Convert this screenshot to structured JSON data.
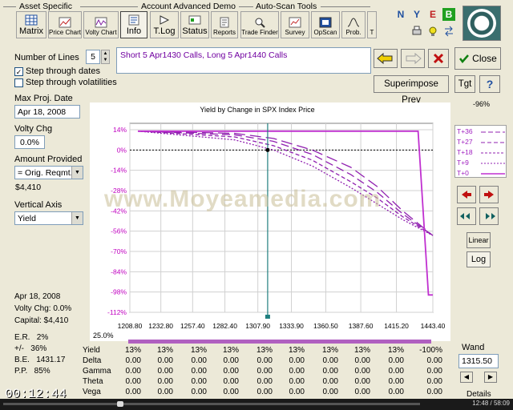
{
  "toolbar": {
    "groups": {
      "asset": "Asset Specific",
      "account": "Account Advanced Demo",
      "autoscan": "Auto-Scan Tools"
    },
    "buttons": {
      "matrix": "Matrix",
      "price_chart": "Price Chart",
      "volty_chart": "Volty Chart",
      "info": "Info",
      "tlog": "T.Log",
      "status": "Status",
      "reports": "Reports",
      "trade_finder": "Trade Finder",
      "survey": "Survey",
      "opscan": "OpScan",
      "prob": "Prob.",
      "extra": "T"
    }
  },
  "right_icons": [
    "N",
    "Y",
    "E",
    "B"
  ],
  "left_panel": {
    "num_lines_label": "Number of Lines",
    "num_lines_value": "5",
    "step_dates_label": "Step through dates",
    "step_vol_label": "Step through volatilities",
    "max_proj_label": "Max Proj. Date",
    "max_proj_value": "Apr 18, 2008",
    "volty_chg_label": "Volty Chg",
    "volty_chg_value": "0.0%",
    "amount_label": "Amount Provided",
    "amount_combo": "= Orig. Reqmt.",
    "amount_value": "$4,410",
    "vaxis_label": "Vertical Axis",
    "vaxis_value": "Yield"
  },
  "description": "Short 5 Apr1430 Calls, Long 5 Apr1440 Calls",
  "buttons": {
    "close": "Close",
    "superimpose": "Superimpose Prev",
    "tgt": "Tgt",
    "help": "?",
    "linear": "Linear",
    "log": "Log",
    "wand": "Wand",
    "details": "Details"
  },
  "scale_top": "-96%",
  "legend": [
    "T+36",
    "T+27",
    "T+18",
    "T+9",
    "T+0"
  ],
  "chart_data": {
    "type": "line",
    "title": "Yield by Change in SPX Index Price",
    "x_ticks": [
      "1208.80",
      "1232.80",
      "1257.40",
      "1282.40",
      "1307.90",
      "1333.90",
      "1360.50",
      "1387.60",
      "1415.20",
      "1443.40"
    ],
    "y_ticks": [
      "14%",
      "0%",
      "-14%",
      "-28%",
      "-42%",
      "-56%",
      "-70%",
      "-84%",
      "-98%",
      "-112%"
    ],
    "xlim": [
      1208.8,
      1443.4
    ],
    "ylim": [
      -112,
      14
    ],
    "series": [
      {
        "name": "T+36",
        "x": [
          1215,
          1290,
          1320,
          1350,
          1380,
          1400,
          1420,
          1443.4
        ],
        "y": [
          13,
          11.5,
          8,
          0,
          -12,
          -25,
          -42,
          -59
        ]
      },
      {
        "name": "T+27",
        "x": [
          1215,
          1290,
          1320,
          1350,
          1380,
          1400,
          1420,
          1443.4
        ],
        "y": [
          13,
          10.5,
          6,
          -3,
          -17,
          -29,
          -44,
          -59
        ]
      },
      {
        "name": "T+18",
        "x": [
          1215,
          1290,
          1320,
          1350,
          1380,
          1400,
          1420,
          1443.4
        ],
        "y": [
          13,
          9,
          3,
          -7,
          -22,
          -33,
          -46,
          -59
        ]
      },
      {
        "name": "T+9",
        "x": [
          1215,
          1290,
          1320,
          1350,
          1380,
          1400,
          1420,
          1443.4
        ],
        "y": [
          13,
          7,
          0,
          -11,
          -26,
          -37,
          -48,
          -59
        ]
      },
      {
        "name": "T+0",
        "x": [
          1215,
          1430,
          1432,
          1440,
          1443.4
        ],
        "y": [
          13,
          13,
          13,
          -100,
          -100
        ]
      }
    ],
    "zero_line_y": 0,
    "cursor_x": 1315.5,
    "pct_label": "25.0%"
  },
  "stats": {
    "date": "Apr 18, 2008",
    "volty": "Volty Chg: 0.0%",
    "capital": "Capital: $4,410",
    "er": "E.R.   2%",
    "pm": "+/-   36%",
    "be": "B.E.   1431.17",
    "pp": "P.P.   85%"
  },
  "table": {
    "rows": [
      {
        "label": "Yield",
        "cells": [
          "13%",
          "13%",
          "13%",
          "13%",
          "13%",
          "13%",
          "13%",
          "13%",
          "13%",
          "-100%"
        ]
      },
      {
        "label": "Delta",
        "cells": [
          "0.00",
          "0.00",
          "0.00",
          "0.00",
          "0.00",
          "0.00",
          "0.00",
          "0.00",
          "0.00",
          "0.00"
        ]
      },
      {
        "label": "Gamma",
        "cells": [
          "0.00",
          "0.00",
          "0.00",
          "0.00",
          "0.00",
          "0.00",
          "0.00",
          "0.00",
          "0.00",
          "0.00"
        ]
      },
      {
        "label": "Theta",
        "cells": [
          "0.00",
          "0.00",
          "0.00",
          "0.00",
          "0.00",
          "0.00",
          "0.00",
          "0.00",
          "0.00",
          "0.00"
        ]
      },
      {
        "label": "Vega",
        "cells": [
          "0.00",
          "0.00",
          "0.00",
          "0.00",
          "0.00",
          "0.00",
          "0.00",
          "0.00",
          "0.00",
          "0.00"
        ]
      }
    ]
  },
  "wand_value": "1315.50",
  "overlay": {
    "timestamp": "00:12:44",
    "watermark": "www.Moyeamedia.com",
    "player_time": "12:48 / 58:09"
  }
}
